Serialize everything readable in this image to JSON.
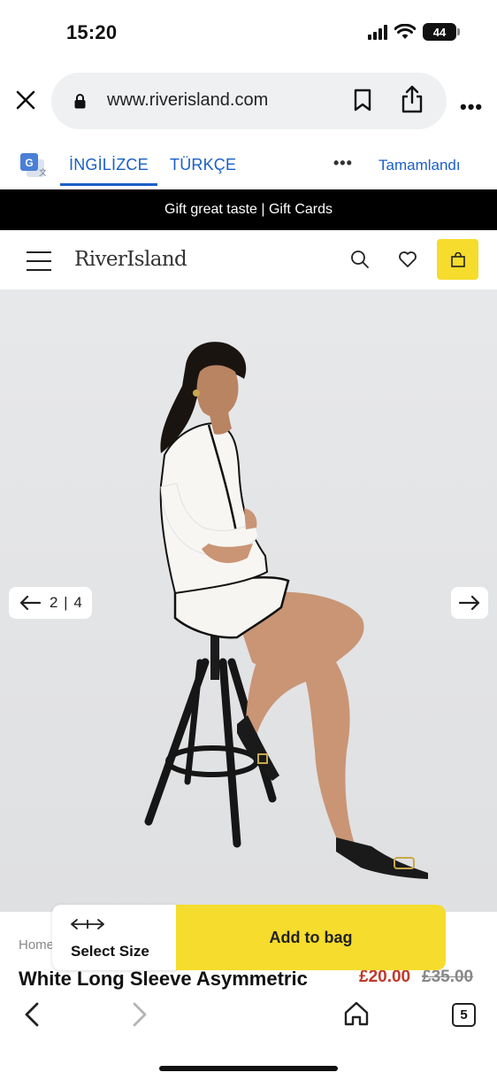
{
  "status_bar": {
    "time": "15:20",
    "battery": "44"
  },
  "browser": {
    "url": "www.riverisland.com"
  },
  "translate_bar": {
    "tab_source": "İNGİLİZCE",
    "tab_target": "TÜRKÇE",
    "more": "•••",
    "done": "Tamamlandı"
  },
  "promo": {
    "text": "Gift great taste | Gift Cards"
  },
  "site": {
    "logo": "RiverIsland"
  },
  "gallery": {
    "counter": "2 | 4",
    "current_image": 2,
    "total_images": 4
  },
  "product": {
    "breadcrumb": "Home",
    "title": "White Long Sleeve Asymmetric",
    "price_now": "£20.00",
    "price_was": "£35.00"
  },
  "actions": {
    "select_size": "Select Size",
    "add_to_bag": "Add to bag"
  },
  "toolbar": {
    "tabs_count": "5"
  },
  "colors": {
    "accent": "#f6dc2c",
    "link": "#1a5fc8",
    "sale": "#c0392b"
  }
}
